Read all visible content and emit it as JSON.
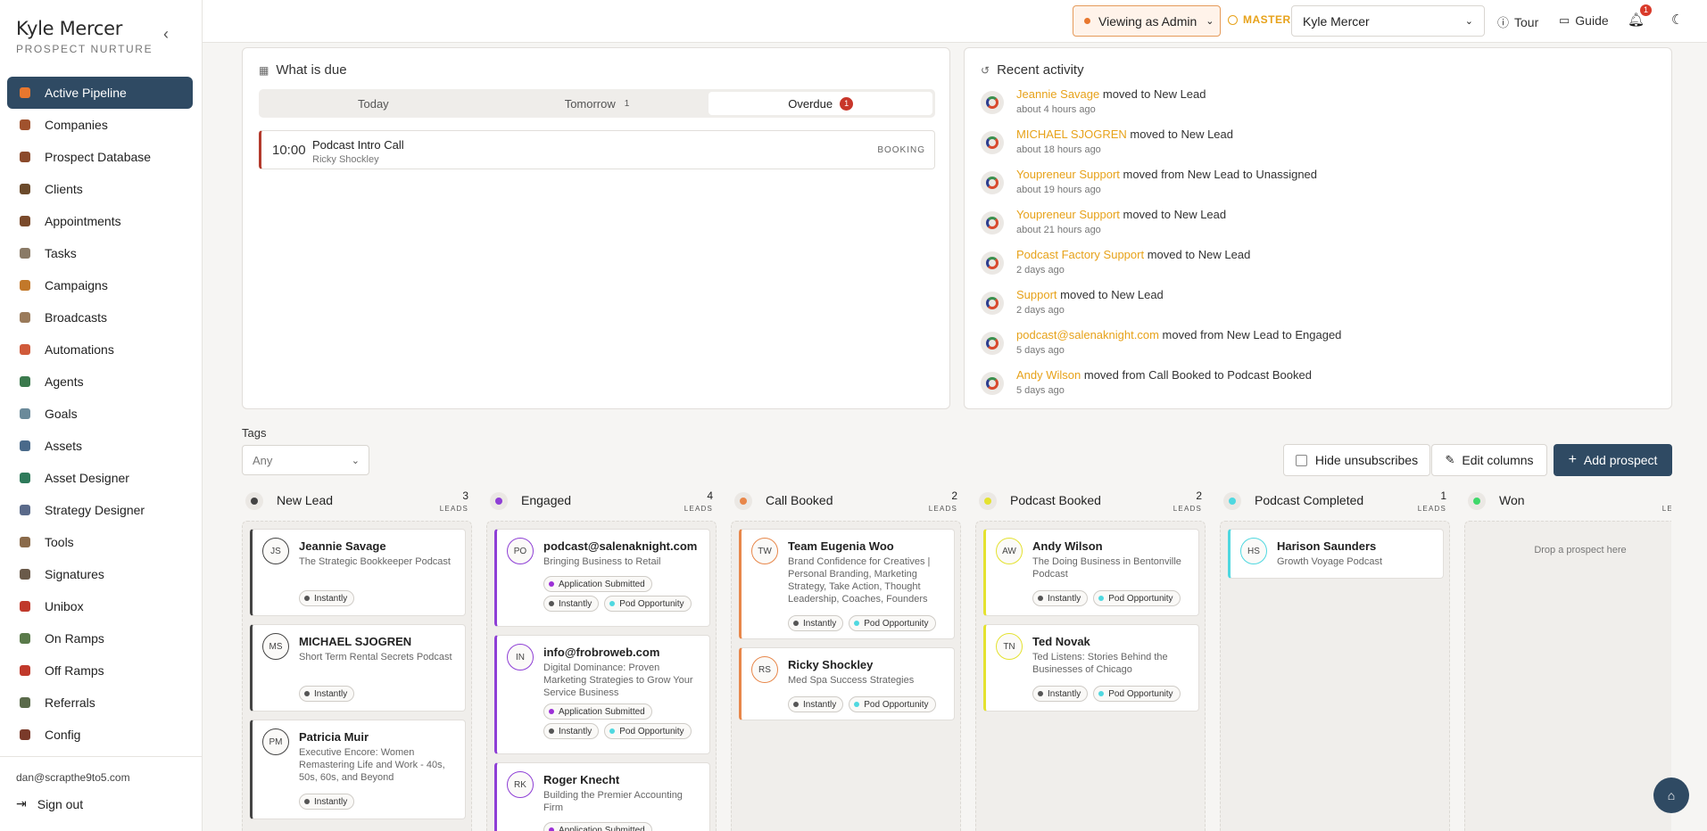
{
  "brand": {
    "name": "Kyle Mercer",
    "subtitle": "PROSPECT NURTURE"
  },
  "sidebar": {
    "items": [
      {
        "label": "Active Pipeline",
        "icon": "pipeline-icon",
        "color": "#e8772e"
      },
      {
        "label": "Companies",
        "icon": "building-icon",
        "color": "#a0522d"
      },
      {
        "label": "Prospect Database",
        "icon": "database-icon",
        "color": "#8b4a2b"
      },
      {
        "label": "Clients",
        "icon": "user-icon",
        "color": "#6b4a2b"
      },
      {
        "label": "Appointments",
        "icon": "calendar-icon",
        "color": "#7a4a2b"
      },
      {
        "label": "Tasks",
        "icon": "clipboard-icon",
        "color": "#8a7a66"
      },
      {
        "label": "Campaigns",
        "icon": "megaphone-icon",
        "color": "#c2782a"
      },
      {
        "label": "Broadcasts",
        "icon": "antenna-icon",
        "color": "#9a7a5a"
      },
      {
        "label": "Automations",
        "icon": "robot-icon",
        "color": "#d05a3a"
      },
      {
        "label": "Agents",
        "icon": "agent-icon",
        "color": "#3b7a4d"
      },
      {
        "label": "Goals",
        "icon": "target-icon",
        "color": "#6a8a9a"
      },
      {
        "label": "Assets",
        "icon": "image-icon",
        "color": "#4a6a8a"
      },
      {
        "label": "Asset Designer",
        "icon": "palette-icon",
        "color": "#2e7a5a"
      },
      {
        "label": "Strategy Designer",
        "icon": "strategy-icon",
        "color": "#5a6a8a"
      },
      {
        "label": "Tools",
        "icon": "hammer-icon",
        "color": "#8a6a4a"
      },
      {
        "label": "Signatures",
        "icon": "pen-icon",
        "color": "#6a5a4a"
      },
      {
        "label": "Unibox",
        "icon": "inbox-icon",
        "color": "#c0392b"
      },
      {
        "label": "On Ramps",
        "icon": "ramp-icon",
        "color": "#5a7a4a"
      },
      {
        "label": "Off Ramps",
        "icon": "lifebuoy-icon",
        "color": "#c0392b"
      },
      {
        "label": "Referrals",
        "icon": "referral-icon",
        "color": "#5a6a4a"
      },
      {
        "label": "Config",
        "icon": "config-icon",
        "color": "#7a3a2a"
      }
    ],
    "email": "dan@scrapthe9to5.com",
    "signout": "Sign out"
  },
  "topbar": {
    "viewing": "Viewing as Admin",
    "master": "MASTER",
    "user": "Kyle Mercer",
    "tour": "Tour",
    "guide": "Guide",
    "notifications": "1"
  },
  "due": {
    "title": "What is due",
    "tabs": {
      "today": "Today",
      "tomorrow": "Tomorrow",
      "tomorrow_count": "1",
      "overdue": "Overdue",
      "overdue_count": "1"
    },
    "item": {
      "time": "10:00",
      "title": "Podcast Intro Call",
      "who": "Ricky Shockley",
      "tag": "BOOKING"
    }
  },
  "activity": {
    "title": "Recent activity",
    "rows": [
      {
        "who": "Jeannie Savage",
        "mid": " moved to New Lead",
        "time": "about 4 hours ago"
      },
      {
        "who": "MICHAEL SJOGREN",
        "mid": " moved to New Lead",
        "time": "about 18 hours ago"
      },
      {
        "who": "Youpreneur Support",
        "mid": " moved from New Lead to Unassigned",
        "time": "about 19 hours ago"
      },
      {
        "who": "Youpreneur Support",
        "mid": " moved to New Lead",
        "time": "about 21 hours ago"
      },
      {
        "who": "Podcast Factory Support",
        "mid": " moved to New Lead",
        "time": "2 days ago"
      },
      {
        "who": "Support",
        "mid": " moved to New Lead",
        "time": "2 days ago"
      },
      {
        "who": "podcast@salenaknight.com",
        "mid": " moved from New Lead to Engaged",
        "time": "5 days ago"
      },
      {
        "who": "Andy Wilson",
        "mid": " moved from Call Booked to Podcast Booked",
        "time": "5 days ago"
      }
    ]
  },
  "toolbar": {
    "tags_label": "Tags",
    "tags_value": "Any",
    "hide_unsubscribes": "Hide unsubscribes",
    "edit_columns": "Edit columns",
    "add_prospect": "Add prospect"
  },
  "leads_label": "LEADS",
  "columns": [
    {
      "name": "New Lead",
      "count": "3",
      "color": "#444444"
    },
    {
      "name": "Engaged",
      "count": "4",
      "color": "#8e3fd6"
    },
    {
      "name": "Call Booked",
      "count": "2",
      "color": "#e8874a"
    },
    {
      "name": "Podcast Booked",
      "count": "2",
      "color": "#e4e22f"
    },
    {
      "name": "Podcast Completed",
      "count": "1",
      "color": "#4fd8e0"
    },
    {
      "name": "Won",
      "count": "",
      "color": "#3fd86a",
      "empty": "Drop a prospect here"
    }
  ],
  "chip_labels": {
    "instantly": "Instantly",
    "pod": "Pod Opportunity",
    "app": "Application Submitted"
  },
  "cards": {
    "c1": {
      "initials": "JS",
      "name": "Jeannie Savage",
      "sub": "The Strategic Bookkeeper Podcast"
    },
    "c2": {
      "initials": "MS",
      "name": "MICHAEL SJOGREN",
      "sub": "Short Term Rental Secrets Podcast"
    },
    "c3": {
      "initials": "PM",
      "name": "Patricia Muir",
      "sub": "Executive Encore: Women Remastering Life and Work - 40s, 50s, 60s, and Beyond"
    },
    "c4": {
      "initials": "PO",
      "name": "podcast@salenaknight.com",
      "sub": "Bringing Business to Retail"
    },
    "c5": {
      "initials": "IN",
      "name": "info@frobroweb.com",
      "sub": "Digital Dominance: Proven Marketing Strategies to Grow Your Service Business"
    },
    "c6": {
      "initials": "RK",
      "name": "Roger Knecht",
      "sub": "Building the Premier Accounting Firm"
    },
    "c7": {
      "initials": "TW",
      "name": "Team Eugenia Woo",
      "sub": "Brand Confidence for Creatives | Personal Branding, Marketing Strategy, Take Action, Thought Leadership, Coaches, Founders"
    },
    "c8": {
      "initials": "RS",
      "name": "Ricky Shockley",
      "sub": "Med Spa Success Strategies"
    },
    "c9": {
      "initials": "AW",
      "name": "Andy Wilson",
      "sub": "The Doing Business in Bentonville Podcast"
    },
    "c10": {
      "initials": "TN",
      "name": "Ted Novak",
      "sub": "Ted Listens: Stories Behind the Businesses of Chicago"
    },
    "c11": {
      "initials": "HS",
      "name": "Harison Saunders",
      "sub": "Growth Voyage Podcast"
    }
  }
}
